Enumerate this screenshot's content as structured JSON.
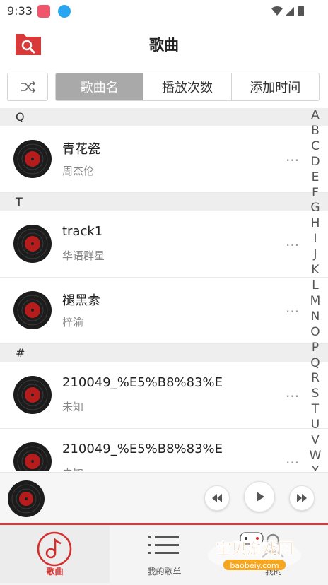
{
  "status_bar": {
    "time": "9:33"
  },
  "header": {
    "title": "歌曲"
  },
  "tabs": {
    "items": [
      "歌曲名",
      "播放次数",
      "添加时间"
    ],
    "active_index": 0
  },
  "sections": [
    {
      "letter": "Q",
      "songs": [
        {
          "title": "青花瓷",
          "artist": "周杰伦"
        }
      ]
    },
    {
      "letter": "T",
      "songs": [
        {
          "title": "track1",
          "artist": "华语群星"
        },
        {
          "title": "褪黑素",
          "artist": "梓渝"
        }
      ]
    },
    {
      "letter": "#",
      "songs": [
        {
          "title": "210049_%E5%B8%83%E",
          "artist": "未知"
        },
        {
          "title": "210049_%E5%B8%83%E",
          "artist": "未知"
        }
      ]
    }
  ],
  "alphabet": [
    "A",
    "B",
    "C",
    "D",
    "E",
    "F",
    "G",
    "H",
    "I",
    "J",
    "K",
    "L",
    "M",
    "N",
    "O",
    "P",
    "Q",
    "R",
    "S",
    "T",
    "U",
    "V",
    "W",
    "X"
  ],
  "more_label": "···",
  "bottom_nav": [
    {
      "label": "歌曲",
      "icon": "music-note-icon",
      "active": true
    },
    {
      "label": "我的歌单",
      "icon": "list-icon",
      "active": false
    },
    {
      "label": "我的",
      "icon": "person-icon",
      "active": false
    }
  ],
  "watermark": {
    "text": "宝贝游戏网",
    "url_text": "baobeiy.com"
  },
  "colors": {
    "accent": "#d32f2f",
    "tab_active": "#a9a9a9",
    "section_bg": "#eeeeee"
  }
}
